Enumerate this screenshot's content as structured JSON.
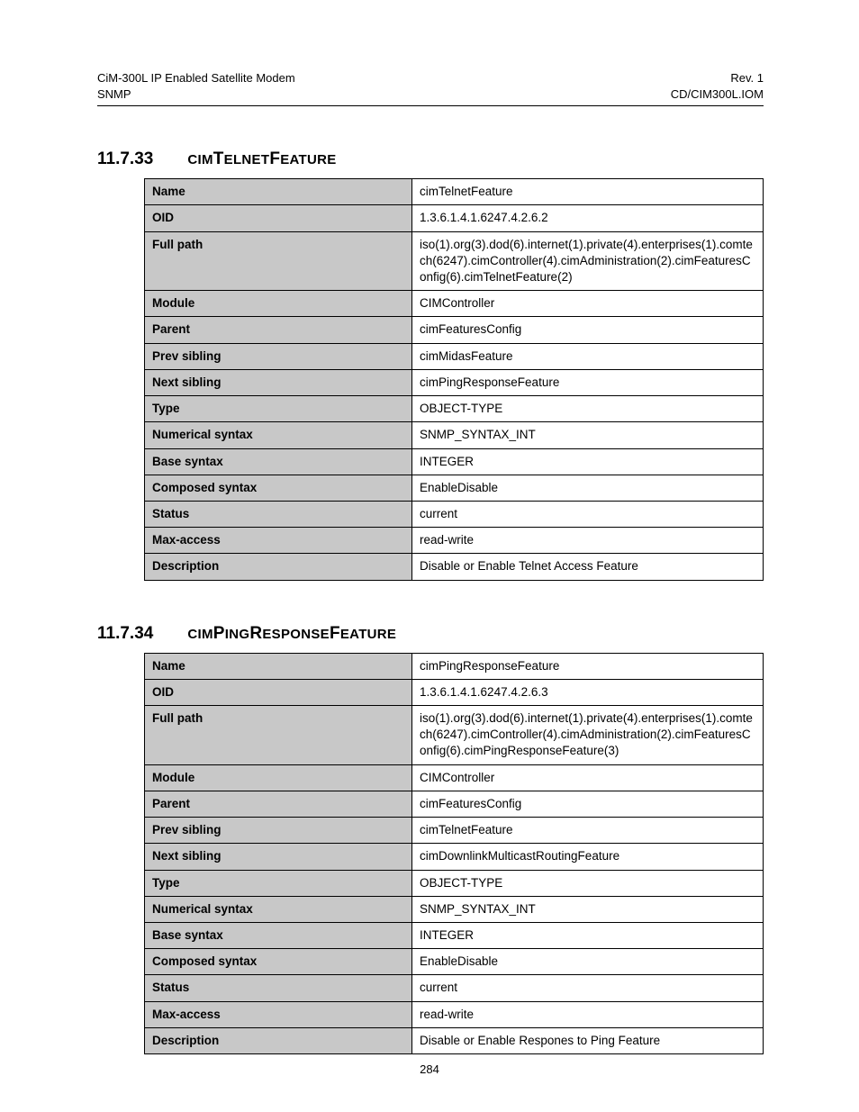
{
  "header": {
    "left_line1": "CiM-300L IP Enabled Satellite Modem",
    "left_line2": "SNMP",
    "right_line1": "Rev. 1",
    "right_line2": "CD/CIM300L.IOM"
  },
  "sections": [
    {
      "number": "11.7.33",
      "title_parts": [
        "CIM",
        "T",
        "ELNET",
        "F",
        "EATURE"
      ],
      "rows": [
        {
          "key": "Name",
          "value": "cimTelnetFeature"
        },
        {
          "key": "OID",
          "value": "1.3.6.1.4.1.6247.4.2.6.2"
        },
        {
          "key": "Full path",
          "value": "iso(1).org(3).dod(6).internet(1).private(4).enterprises(1).comtech(6247).cimController(4).cimAdministration(2).cimFeaturesConfig(6).cimTelnetFeature(2)"
        },
        {
          "key": "Module",
          "value": "CIMController"
        },
        {
          "key": "Parent",
          "value": "cimFeaturesConfig"
        },
        {
          "key": "Prev sibling",
          "value": "cimMidasFeature"
        },
        {
          "key": "Next sibling",
          "value": "cimPingResponseFeature"
        },
        {
          "key": "Type",
          "value": "OBJECT-TYPE"
        },
        {
          "key": "Numerical syntax",
          "value": "SNMP_SYNTAX_INT"
        },
        {
          "key": "Base syntax",
          "value": "INTEGER"
        },
        {
          "key": "Composed syntax",
          "value": "EnableDisable"
        },
        {
          "key": "Status",
          "value": "current"
        },
        {
          "key": "Max-access",
          "value": "read-write"
        },
        {
          "key": "Description",
          "value": "Disable or Enable Telnet Access Feature"
        }
      ]
    },
    {
      "number": "11.7.34",
      "title_parts": [
        "CIM",
        "P",
        "ING",
        "R",
        "ESPONSE",
        "F",
        "EATURE"
      ],
      "rows": [
        {
          "key": "Name",
          "value": "cimPingResponseFeature"
        },
        {
          "key": "OID",
          "value": "1.3.6.1.4.1.6247.4.2.6.3"
        },
        {
          "key": "Full path",
          "value": "iso(1).org(3).dod(6).internet(1).private(4).enterprises(1).comtech(6247).cimController(4).cimAdministration(2).cimFeaturesConfig(6).cimPingResponseFeature(3)"
        },
        {
          "key": "Module",
          "value": "CIMController"
        },
        {
          "key": "Parent",
          "value": "cimFeaturesConfig"
        },
        {
          "key": "Prev sibling",
          "value": "cimTelnetFeature"
        },
        {
          "key": "Next sibling",
          "value": "cimDownlinkMulticastRoutingFeature"
        },
        {
          "key": "Type",
          "value": "OBJECT-TYPE"
        },
        {
          "key": "Numerical syntax",
          "value": "SNMP_SYNTAX_INT"
        },
        {
          "key": "Base syntax",
          "value": "INTEGER"
        },
        {
          "key": "Composed syntax",
          "value": "EnableDisable"
        },
        {
          "key": "Status",
          "value": "current"
        },
        {
          "key": "Max-access",
          "value": "read-write"
        },
        {
          "key": "Description",
          "value": "Disable or Enable Respones to Ping Feature"
        }
      ]
    }
  ],
  "page_number": "284"
}
